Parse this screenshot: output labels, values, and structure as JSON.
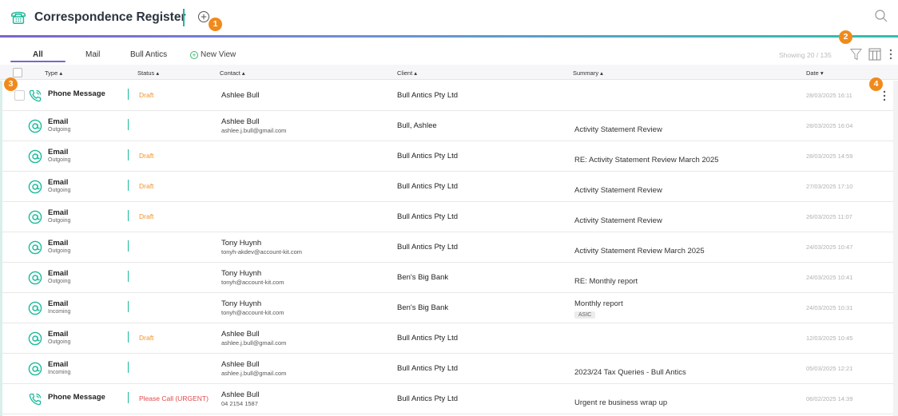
{
  "app": {
    "title": "Correspondence Register"
  },
  "badges": [
    "1",
    "2",
    "3",
    "4"
  ],
  "tabs": [
    {
      "label": "All",
      "active": true
    },
    {
      "label": "Mail",
      "active": false
    },
    {
      "label": "Bull Antics",
      "active": false
    }
  ],
  "new_view_label": "New View",
  "showing": "Showing 20 / 135",
  "columns": [
    "Type ▴",
    "Status ▴",
    "Contact ▴",
    "Client ▴",
    "Summary ▴",
    "Date ▾"
  ],
  "colors": {
    "accent_purple": "#7b65c9",
    "accent_teal": "#1aba9a",
    "draft": "#f0922a",
    "urgent": "#e24a4a",
    "badge": "#f08a1c"
  },
  "rows": [
    {
      "icon": "phone-icon",
      "type": "Phone Message",
      "sub": "",
      "status": "Draft",
      "status_kind": "draft",
      "contact": "Ashlee Bull",
      "contact_sub": "",
      "client": "Bull Antics Pty Ltd",
      "summary": "",
      "tag": "",
      "date": "28/03/2025 16:11"
    },
    {
      "icon": "email-icon",
      "type": "Email",
      "sub": "Outgoing",
      "status": "",
      "status_kind": "",
      "contact": "Ashlee Bull",
      "contact_sub": "ashlee.j.bull@gmail.com",
      "client": "Bull, Ashlee",
      "summary": "Activity Statement Review",
      "tag": "",
      "date": "28/03/2025 16:04"
    },
    {
      "icon": "email-icon",
      "type": "Email",
      "sub": "Outgoing",
      "status": "Draft",
      "status_kind": "draft",
      "contact": "",
      "contact_sub": "",
      "client": "Bull Antics Pty Ltd",
      "summary": "RE: Activity Statement Review March 2025",
      "tag": "",
      "date": "28/03/2025 14:59"
    },
    {
      "icon": "email-icon",
      "type": "Email",
      "sub": "Outgoing",
      "status": "Draft",
      "status_kind": "draft",
      "contact": "",
      "contact_sub": "",
      "client": "Bull Antics Pty Ltd",
      "summary": "Activity Statement Review",
      "tag": "",
      "date": "27/03/2025 17:10"
    },
    {
      "icon": "email-icon",
      "type": "Email",
      "sub": "Outgoing",
      "status": "Draft",
      "status_kind": "draft",
      "contact": "",
      "contact_sub": "",
      "client": "Bull Antics Pty Ltd",
      "summary": "Activity Statement Review",
      "tag": "",
      "date": "26/03/2025 11:07"
    },
    {
      "icon": "email-icon",
      "type": "Email",
      "sub": "Outgoing",
      "status": "",
      "status_kind": "",
      "contact": "Tony Huynh",
      "contact_sub": "tonyh-akdev@account-kit.com",
      "client": "Bull Antics Pty Ltd",
      "summary": "Activity Statement Review March 2025",
      "tag": "",
      "date": "24/03/2025 10:47"
    },
    {
      "icon": "email-icon",
      "type": "Email",
      "sub": "Outgoing",
      "status": "",
      "status_kind": "",
      "contact": "Tony Huynh",
      "contact_sub": "tonyh@account-kit.com",
      "client": "Ben's Big Bank",
      "summary": "RE: Monthly report",
      "tag": "",
      "date": "24/03/2025 10:41"
    },
    {
      "icon": "email-icon",
      "type": "Email",
      "sub": "Incoming",
      "status": "",
      "status_kind": "",
      "contact": "Tony Huynh",
      "contact_sub": "tonyh@account-kit.com",
      "client": "Ben's Big Bank",
      "summary": "Monthly report",
      "tag": "ASIC",
      "date": "24/03/2025 10:31"
    },
    {
      "icon": "email-icon",
      "type": "Email",
      "sub": "Outgoing",
      "status": "Draft",
      "status_kind": "draft",
      "contact": "Ashlee Bull",
      "contact_sub": "ashlee.j.bull@gmail.com",
      "client": "Bull Antics Pty Ltd",
      "summary": "",
      "tag": "",
      "date": "12/03/2025 10:45"
    },
    {
      "icon": "email-icon",
      "type": "Email",
      "sub": "Incoming",
      "status": "",
      "status_kind": "",
      "contact": "Ashlee Bull",
      "contact_sub": "ashlee.j.bull@gmail.com",
      "client": "Bull Antics Pty Ltd",
      "summary": "2023/24 Tax Queries - Bull Antics",
      "tag": "",
      "date": "05/03/2025 12:21"
    },
    {
      "icon": "phone-icon",
      "type": "Phone Message",
      "sub": "",
      "status": "Please Call (URGENT)",
      "status_kind": "urgent",
      "contact": "Ashlee Bull",
      "contact_sub": "04 2154 1587",
      "client": "Bull Antics Pty Ltd",
      "summary": "Urgent re business wrap up",
      "tag": "",
      "date": "06/02/2025 14:39"
    }
  ]
}
